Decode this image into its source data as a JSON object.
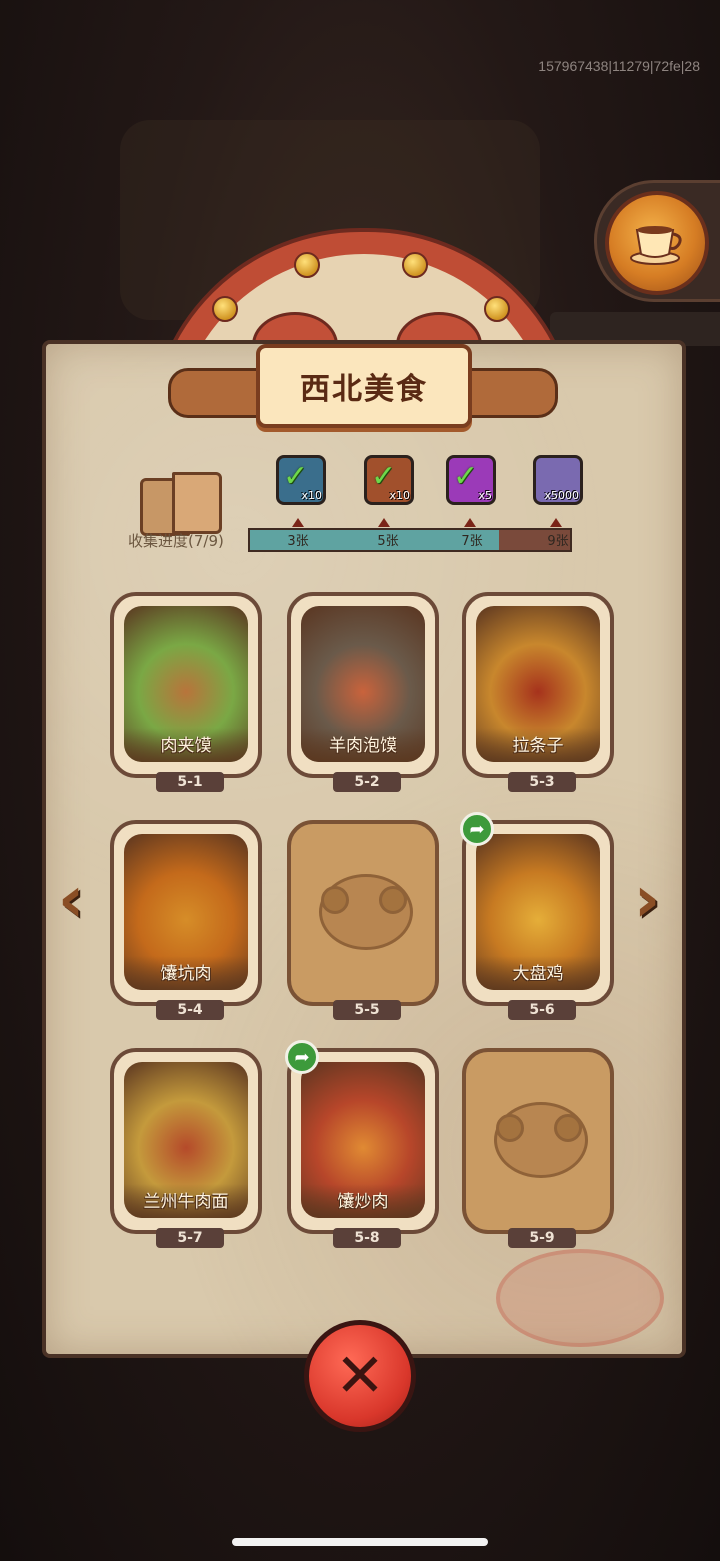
{
  "debug_id": "157967438|11279|72fe|28",
  "title": "西北美食",
  "progress": {
    "label": "收集进度(7/9)",
    "collected": 7,
    "total": 9,
    "milestones": [
      {
        "label": "3张",
        "reward_qty": "x10",
        "reward_icon": "chest-icon",
        "claimed": true,
        "color": "#3a6e8c"
      },
      {
        "label": "5张",
        "reward_qty": "x10",
        "reward_icon": "scroll-icon",
        "claimed": true,
        "color": "#a1502c"
      },
      {
        "label": "7张",
        "reward_qty": "x5",
        "reward_icon": "orb-icon",
        "claimed": true,
        "color": "#9b3ab8"
      },
      {
        "label": "9张",
        "reward_qty": "x5000",
        "reward_icon": "crystal-icon",
        "claimed": false,
        "color": "#7a6ab0"
      }
    ]
  },
  "cards": [
    {
      "id": "5-1",
      "name": "肉夹馍",
      "unlocked": true,
      "share": false
    },
    {
      "id": "5-2",
      "name": "羊肉泡馍",
      "unlocked": true,
      "share": false
    },
    {
      "id": "5-3",
      "name": "拉条子",
      "unlocked": true,
      "share": false
    },
    {
      "id": "5-4",
      "name": "馕坑肉",
      "unlocked": true,
      "share": false
    },
    {
      "id": "5-5",
      "name": "",
      "unlocked": false,
      "share": false
    },
    {
      "id": "5-6",
      "name": "大盘鸡",
      "unlocked": true,
      "share": true
    },
    {
      "id": "5-7",
      "name": "兰州牛肉面",
      "unlocked": true,
      "share": false
    },
    {
      "id": "5-8",
      "name": "馕炒肉",
      "unlocked": true,
      "share": true
    },
    {
      "id": "5-9",
      "name": "",
      "unlocked": false,
      "share": false
    }
  ],
  "nav": {
    "prev_icon": "chevron-left-icon",
    "next_icon": "chevron-right-icon"
  },
  "close_icon": "close-icon"
}
